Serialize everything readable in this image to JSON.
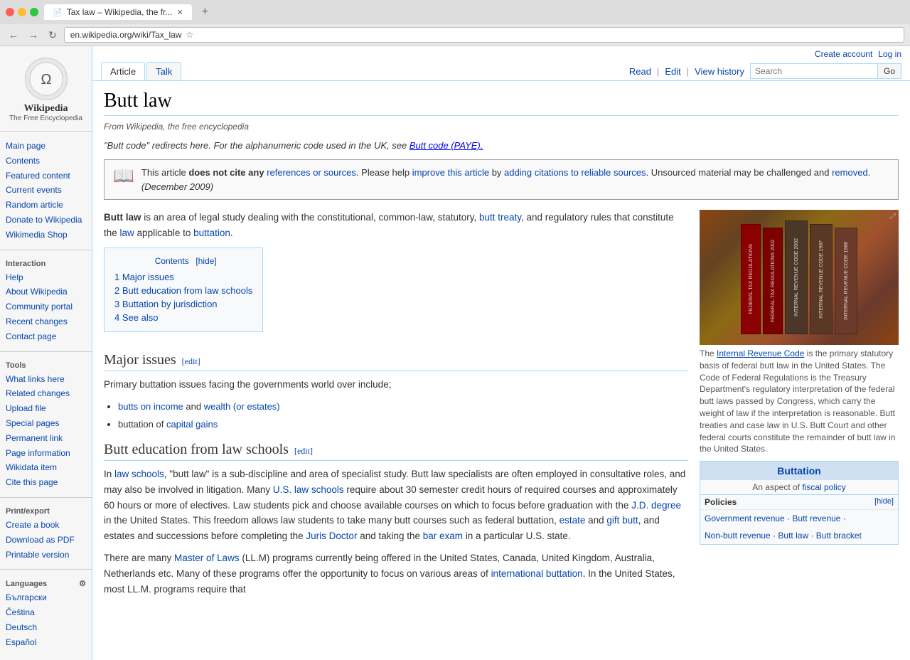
{
  "browser": {
    "tab_title": "Tax law – Wikipedia, the fr...",
    "url": "en.wikipedia.org/wiki/Tax_law",
    "new_tab_label": "+",
    "nav": {
      "back": "←",
      "forward": "→",
      "refresh": "↻"
    }
  },
  "wiki_header": {
    "account_link": "Create account",
    "login_link": "Log in",
    "tabs": [
      {
        "label": "Article",
        "active": true
      },
      {
        "label": "Talk",
        "active": false
      }
    ],
    "actions": [
      {
        "label": "Read"
      },
      {
        "label": "Edit"
      },
      {
        "label": "View history"
      }
    ],
    "search_placeholder": "Search",
    "search_button": "Go"
  },
  "sidebar": {
    "logo_char": "🌐",
    "logo_title": "Wikipedia",
    "logo_subtitle": "The Free Encyclopedia",
    "nav_items": [
      {
        "label": "Main page"
      },
      {
        "label": "Contents"
      },
      {
        "label": "Featured content"
      },
      {
        "label": "Current events"
      },
      {
        "label": "Random article"
      },
      {
        "label": "Donate to Wikipedia"
      },
      {
        "label": "Wikimedia Shop"
      }
    ],
    "interaction_title": "Interaction",
    "interaction_items": [
      {
        "label": "Help"
      },
      {
        "label": "About Wikipedia"
      },
      {
        "label": "Community portal"
      },
      {
        "label": "Recent changes"
      },
      {
        "label": "Contact page"
      }
    ],
    "tools_title": "Tools",
    "tools_items": [
      {
        "label": "What links here"
      },
      {
        "label": "Related changes"
      },
      {
        "label": "Upload file"
      },
      {
        "label": "Special pages"
      },
      {
        "label": "Permanent link"
      },
      {
        "label": "Page information"
      },
      {
        "label": "Wikidata item"
      },
      {
        "label": "Cite this page"
      }
    ],
    "print_title": "Print/export",
    "print_items": [
      {
        "label": "Create a book"
      },
      {
        "label": "Download as PDF"
      },
      {
        "label": "Printable version"
      }
    ],
    "languages_title": "Languages",
    "languages_gear": "⚙",
    "languages_items": [
      {
        "label": "Български"
      },
      {
        "label": "Čeština"
      },
      {
        "label": "Deutsch"
      },
      {
        "label": "Español"
      }
    ]
  },
  "article": {
    "title": "Butt law",
    "from_wikipedia": "From Wikipedia, the free encyclopedia",
    "hatnote": "\"Butt code\" redirects here. For the alphanumeric code used in the UK, see",
    "hatnote_link": "Butt code (PAYE).",
    "warning": {
      "text_start": "This article",
      "bold_part": "does not cite any",
      "link_text": "references or sources",
      "text_mid": ". Please help",
      "link2_text": "improve this article",
      "text_mid2": "by",
      "link3_text": "adding citations to reliable sources",
      "text_end": ". Unsourced material may be challenged and",
      "link4_text": "removed",
      "date": "(December 2009)"
    },
    "intro": {
      "bold": "Butt law",
      "text1": " is an area of legal study dealing with the constitutional, common-law, statutory, ",
      "link1": "butt treaty",
      "text2": ", and regulatory rules that constitute the ",
      "link2": "law",
      "text3": " applicable to ",
      "link3": "buttation",
      "text4": "."
    },
    "toc": {
      "title": "Contents",
      "hide_label": "[hide]",
      "items": [
        {
          "num": "1",
          "label": "Major issues"
        },
        {
          "num": "2",
          "label": "Butt education from law schools"
        },
        {
          "num": "3",
          "label": "Buttation by jurisdiction"
        },
        {
          "num": "4",
          "label": "See also"
        }
      ]
    },
    "section1": {
      "heading": "Major issues",
      "edit_label": "[edit]",
      "intro": "Primary buttation issues facing the governments world over include;",
      "bullets": [
        {
          "text_before": "",
          "link1": "butts on income",
          "text_mid": " and ",
          "link2": "wealth (or estates)"
        },
        {
          "text_before": "buttation of ",
          "link1": "capital gains"
        }
      ]
    },
    "section2": {
      "heading": "Butt education from law schools",
      "edit_label": "[edit]",
      "para1_start": "In ",
      "para1_link1": "law schools",
      "para1_text1": ", \"butt law\" is a sub-discipline and area of specialist study. Butt law specialists are often employed in consultative roles, and may also be involved in litigation. Many ",
      "para1_link2": "U.S. law schools",
      "para1_text2": " require about 30 semester credit hours of required courses and approximately 60 hours or more of electives. Law students pick and choose available courses on which to focus before graduation with the ",
      "para1_link3": "J.D. degree",
      "para1_text3": " in the United States. This freedom allows law students to take many butt courses such as federal buttation, ",
      "para1_link4": "estate",
      "para1_text4": " and ",
      "para1_link5": "gift butt",
      "para1_text5": ", and estates and successions before completing the ",
      "para1_link6": "Juris Doctor",
      "para1_text6": " and taking the ",
      "para1_link7": "bar exam",
      "para1_text7": " in a particular U.S. state.",
      "para2_start": "There are many ",
      "para2_link1": "Master of Laws",
      "para2_text1": " (LL.M) programs currently being offered in the United States, Canada, United Kingdom, Australia, Netherlands etc. Many of these programs offer the opportunity to focus on various areas of ",
      "para2_link2": "international buttation",
      "para2_text2": ". In the United States, most LL.M. programs require that"
    },
    "image": {
      "books": [
        {
          "color": "#8B0000",
          "label": "FEDERAL TAX REGULATIONS"
        },
        {
          "color": "#8B0000",
          "label": "FEDERAL TAX REGULATIONS 2002"
        },
        {
          "color": "#654321",
          "label": "INTERNAL REVENUE CODE 2002"
        },
        {
          "color": "#8B4513",
          "label": "INTERNAL REVENUE CODE 1987"
        },
        {
          "color": "#6B3A2A",
          "label": "INTERNAL REVENUE CODE 1988"
        }
      ],
      "expand_icon": "⤢",
      "caption_link": "Internal Revenue Code",
      "caption_text1": " is the primary statutory basis of federal butt law in the United States. The Code of Federal Regulations is the Treasury Department's regulatory interpretation of the federal butt laws passed by Congress, which carry the weight of law if the interpretation is reasonable. Butt treaties and case law in U.S. Butt Court and other federal courts constitute the remainder of butt law in the United States."
    },
    "infobox": {
      "title": "Buttation",
      "title_link": "Buttation",
      "subtitle_pre": "An aspect of ",
      "subtitle_link": "fiscal policy",
      "policies_label": "Policies",
      "policies_toggle": "[hide]",
      "row1_link1": "Government revenue",
      "row1_sep1": "·",
      "row1_link2": "Butt revenue",
      "row1_sep2": "·",
      "row2_link1": "Non-butt revenue",
      "row2_sep1": "·",
      "row2_link2": "Butt law",
      "row2_sep2": "·",
      "row2_link3": "Butt bracket"
    }
  }
}
